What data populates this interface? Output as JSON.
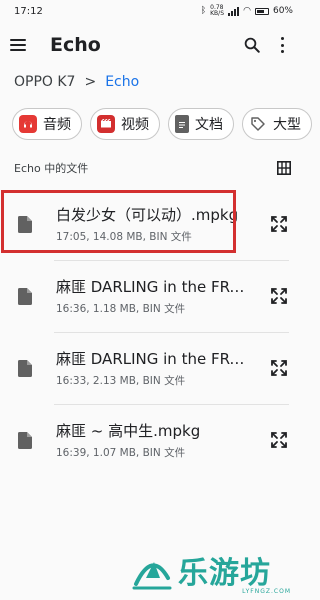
{
  "status_bar": {
    "time": "17:12",
    "network_speed": "0.78 KB/S",
    "battery": "60%"
  },
  "app_bar": {
    "title": "Echo",
    "menu_icon": "hamburger-menu-icon",
    "search_icon": "search-icon",
    "more_icon": "more-vert-icon"
  },
  "breadcrumb": {
    "root": "OPPO K7",
    "separator": ">",
    "current": "Echo"
  },
  "chips": [
    {
      "label": "音频",
      "icon": "audio-icon",
      "color": "#e53935"
    },
    {
      "label": "视频",
      "icon": "video-icon",
      "color": "#d32f2f"
    },
    {
      "label": "文档",
      "icon": "document-icon",
      "color": "#616161"
    },
    {
      "label": "大型",
      "icon": "tag-icon",
      "color": "#616161"
    }
  ],
  "section": {
    "title": "Echo 中的文件",
    "view_toggle_icon": "grid-view-icon"
  },
  "files": [
    {
      "name": "白发少女（可以动）.mpkg",
      "meta": "17:05, 14.08 MB, BIN 文件",
      "highlighted": true
    },
    {
      "name": "麻匪 DARLING in the FRANXX.mpkg",
      "meta": "16:36, 1.18 MB, BIN 文件",
      "highlighted": false
    },
    {
      "name": "麻匪 DARLING in the FRANXX.mpkg",
      "meta": "16:33, 2.13 MB, BIN 文件",
      "highlighted": false
    },
    {
      "name": "麻匪 ~ 高中生.mpkg",
      "meta": "16:39, 1.07 MB, BIN 文件",
      "highlighted": false
    }
  ],
  "watermark": {
    "text": "乐游坊",
    "sub": "LYFNGZ.COM"
  },
  "colors": {
    "accent": "#1a73e8",
    "highlight": "#d32f2f",
    "watermark": "#26a69a"
  }
}
